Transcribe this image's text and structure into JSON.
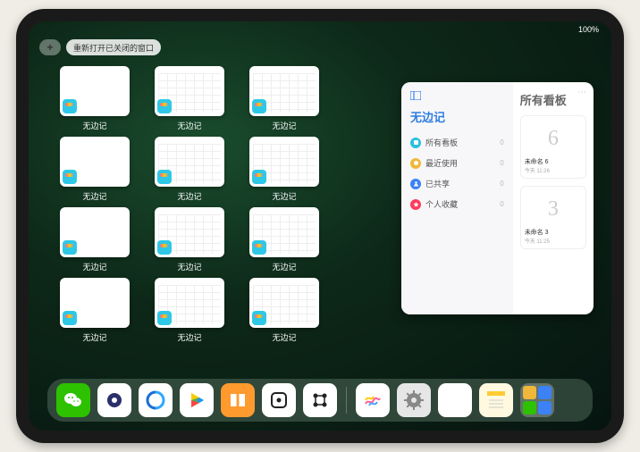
{
  "status": {
    "time": "",
    "battery": "100%"
  },
  "topbar": {
    "plus": "+",
    "reopen_label": "重新打开已关闭的窗口"
  },
  "app_name": "无边记",
  "grid": {
    "tiles": [
      {
        "label": "无边记",
        "variant": "blank"
      },
      {
        "label": "无边记",
        "variant": "calendar"
      },
      {
        "label": "无边记",
        "variant": "calendar"
      },
      {
        "label": "无边记",
        "variant": "blank"
      },
      {
        "label": "无边记",
        "variant": "calendar"
      },
      {
        "label": "无边记",
        "variant": "calendar"
      },
      {
        "label": "无边记",
        "variant": "blank"
      },
      {
        "label": "无边记",
        "variant": "calendar"
      },
      {
        "label": "无边记",
        "variant": "calendar"
      },
      {
        "label": "无边记",
        "variant": "blank"
      },
      {
        "label": "无边记",
        "variant": "calendar"
      },
      {
        "label": "无边记",
        "variant": "calendar"
      }
    ]
  },
  "panel": {
    "left_title": "无边记",
    "right_title": "所有看板",
    "categories": [
      {
        "label": "所有看板",
        "count": "0",
        "color": "#29c0e0"
      },
      {
        "label": "最近使用",
        "count": "0",
        "color": "#f0b83a"
      },
      {
        "label": "已共享",
        "count": "0",
        "color": "#3b82f6"
      },
      {
        "label": "个人收藏",
        "count": "0",
        "color": "#ff3b5c"
      }
    ],
    "boards": [
      {
        "name": "未命名 6",
        "time": "今天 11:26",
        "sketch": "6"
      },
      {
        "name": "未命名 3",
        "time": "今天 11:25",
        "sketch": "3"
      }
    ]
  },
  "dock": {
    "icons": [
      {
        "name": "wechat-icon",
        "bg": "#2dc100",
        "glyph": "wechat"
      },
      {
        "name": "quark-icon",
        "bg": "#ffffff",
        "glyph": "quark"
      },
      {
        "name": "qqbrowser-icon",
        "bg": "#ffffff",
        "glyph": "qqb"
      },
      {
        "name": "play-icon",
        "bg": "#ffffff",
        "glyph": "play"
      },
      {
        "name": "books-icon",
        "bg": "#ff9a2e",
        "glyph": "books"
      },
      {
        "name": "dice-icon",
        "bg": "#ffffff",
        "glyph": "dice"
      },
      {
        "name": "connect-icon",
        "bg": "#ffffff",
        "glyph": "connect"
      }
    ],
    "recent": [
      {
        "name": "freeform-icon",
        "bg": "#ffffff",
        "glyph": "freeform"
      },
      {
        "name": "settings-icon",
        "bg": "#e6e6e6",
        "glyph": "gear"
      },
      {
        "name": "app3-icon",
        "bg": "#ffffff",
        "glyph": "blank"
      },
      {
        "name": "notes-icon",
        "bg": "#fff9e0",
        "glyph": "notes"
      }
    ],
    "group_colors": [
      "#f0b83a",
      "#3b82f6",
      "#2dc100",
      "#3b82f6"
    ]
  }
}
